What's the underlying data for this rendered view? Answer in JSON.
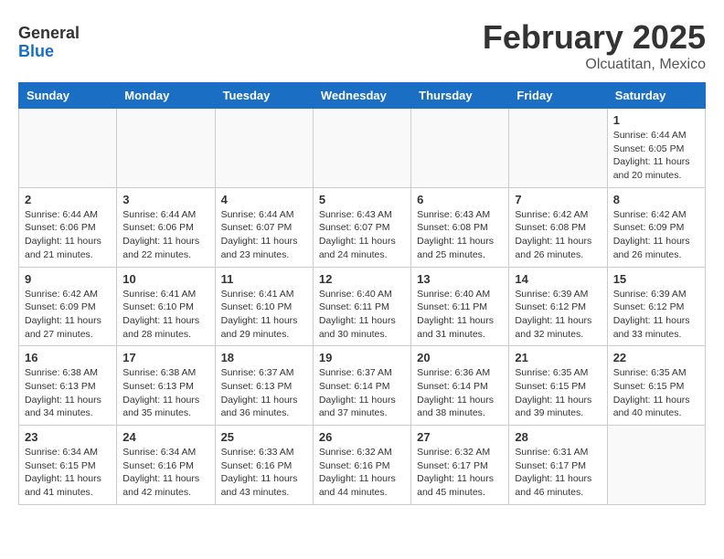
{
  "header": {
    "logo_general": "General",
    "logo_blue": "Blue",
    "month_year": "February 2025",
    "location": "Olcuatitan, Mexico"
  },
  "days_of_week": [
    "Sunday",
    "Monday",
    "Tuesday",
    "Wednesday",
    "Thursday",
    "Friday",
    "Saturday"
  ],
  "weeks": [
    [
      {
        "day": "",
        "info": ""
      },
      {
        "day": "",
        "info": ""
      },
      {
        "day": "",
        "info": ""
      },
      {
        "day": "",
        "info": ""
      },
      {
        "day": "",
        "info": ""
      },
      {
        "day": "",
        "info": ""
      },
      {
        "day": "1",
        "info": "Sunrise: 6:44 AM\nSunset: 6:05 PM\nDaylight: 11 hours\nand 20 minutes."
      }
    ],
    [
      {
        "day": "2",
        "info": "Sunrise: 6:44 AM\nSunset: 6:06 PM\nDaylight: 11 hours\nand 21 minutes."
      },
      {
        "day": "3",
        "info": "Sunrise: 6:44 AM\nSunset: 6:06 PM\nDaylight: 11 hours\nand 22 minutes."
      },
      {
        "day": "4",
        "info": "Sunrise: 6:44 AM\nSunset: 6:07 PM\nDaylight: 11 hours\nand 23 minutes."
      },
      {
        "day": "5",
        "info": "Sunrise: 6:43 AM\nSunset: 6:07 PM\nDaylight: 11 hours\nand 24 minutes."
      },
      {
        "day": "6",
        "info": "Sunrise: 6:43 AM\nSunset: 6:08 PM\nDaylight: 11 hours\nand 25 minutes."
      },
      {
        "day": "7",
        "info": "Sunrise: 6:42 AM\nSunset: 6:08 PM\nDaylight: 11 hours\nand 26 minutes."
      },
      {
        "day": "8",
        "info": "Sunrise: 6:42 AM\nSunset: 6:09 PM\nDaylight: 11 hours\nand 26 minutes."
      }
    ],
    [
      {
        "day": "9",
        "info": "Sunrise: 6:42 AM\nSunset: 6:09 PM\nDaylight: 11 hours\nand 27 minutes."
      },
      {
        "day": "10",
        "info": "Sunrise: 6:41 AM\nSunset: 6:10 PM\nDaylight: 11 hours\nand 28 minutes."
      },
      {
        "day": "11",
        "info": "Sunrise: 6:41 AM\nSunset: 6:10 PM\nDaylight: 11 hours\nand 29 minutes."
      },
      {
        "day": "12",
        "info": "Sunrise: 6:40 AM\nSunset: 6:11 PM\nDaylight: 11 hours\nand 30 minutes."
      },
      {
        "day": "13",
        "info": "Sunrise: 6:40 AM\nSunset: 6:11 PM\nDaylight: 11 hours\nand 31 minutes."
      },
      {
        "day": "14",
        "info": "Sunrise: 6:39 AM\nSunset: 6:12 PM\nDaylight: 11 hours\nand 32 minutes."
      },
      {
        "day": "15",
        "info": "Sunrise: 6:39 AM\nSunset: 6:12 PM\nDaylight: 11 hours\nand 33 minutes."
      }
    ],
    [
      {
        "day": "16",
        "info": "Sunrise: 6:38 AM\nSunset: 6:13 PM\nDaylight: 11 hours\nand 34 minutes."
      },
      {
        "day": "17",
        "info": "Sunrise: 6:38 AM\nSunset: 6:13 PM\nDaylight: 11 hours\nand 35 minutes."
      },
      {
        "day": "18",
        "info": "Sunrise: 6:37 AM\nSunset: 6:13 PM\nDaylight: 11 hours\nand 36 minutes."
      },
      {
        "day": "19",
        "info": "Sunrise: 6:37 AM\nSunset: 6:14 PM\nDaylight: 11 hours\nand 37 minutes."
      },
      {
        "day": "20",
        "info": "Sunrise: 6:36 AM\nSunset: 6:14 PM\nDaylight: 11 hours\nand 38 minutes."
      },
      {
        "day": "21",
        "info": "Sunrise: 6:35 AM\nSunset: 6:15 PM\nDaylight: 11 hours\nand 39 minutes."
      },
      {
        "day": "22",
        "info": "Sunrise: 6:35 AM\nSunset: 6:15 PM\nDaylight: 11 hours\nand 40 minutes."
      }
    ],
    [
      {
        "day": "23",
        "info": "Sunrise: 6:34 AM\nSunset: 6:15 PM\nDaylight: 11 hours\nand 41 minutes."
      },
      {
        "day": "24",
        "info": "Sunrise: 6:34 AM\nSunset: 6:16 PM\nDaylight: 11 hours\nand 42 minutes."
      },
      {
        "day": "25",
        "info": "Sunrise: 6:33 AM\nSunset: 6:16 PM\nDaylight: 11 hours\nand 43 minutes."
      },
      {
        "day": "26",
        "info": "Sunrise: 6:32 AM\nSunset: 6:16 PM\nDaylight: 11 hours\nand 44 minutes."
      },
      {
        "day": "27",
        "info": "Sunrise: 6:32 AM\nSunset: 6:17 PM\nDaylight: 11 hours\nand 45 minutes."
      },
      {
        "day": "28",
        "info": "Sunrise: 6:31 AM\nSunset: 6:17 PM\nDaylight: 11 hours\nand 46 minutes."
      },
      {
        "day": "",
        "info": ""
      }
    ]
  ]
}
